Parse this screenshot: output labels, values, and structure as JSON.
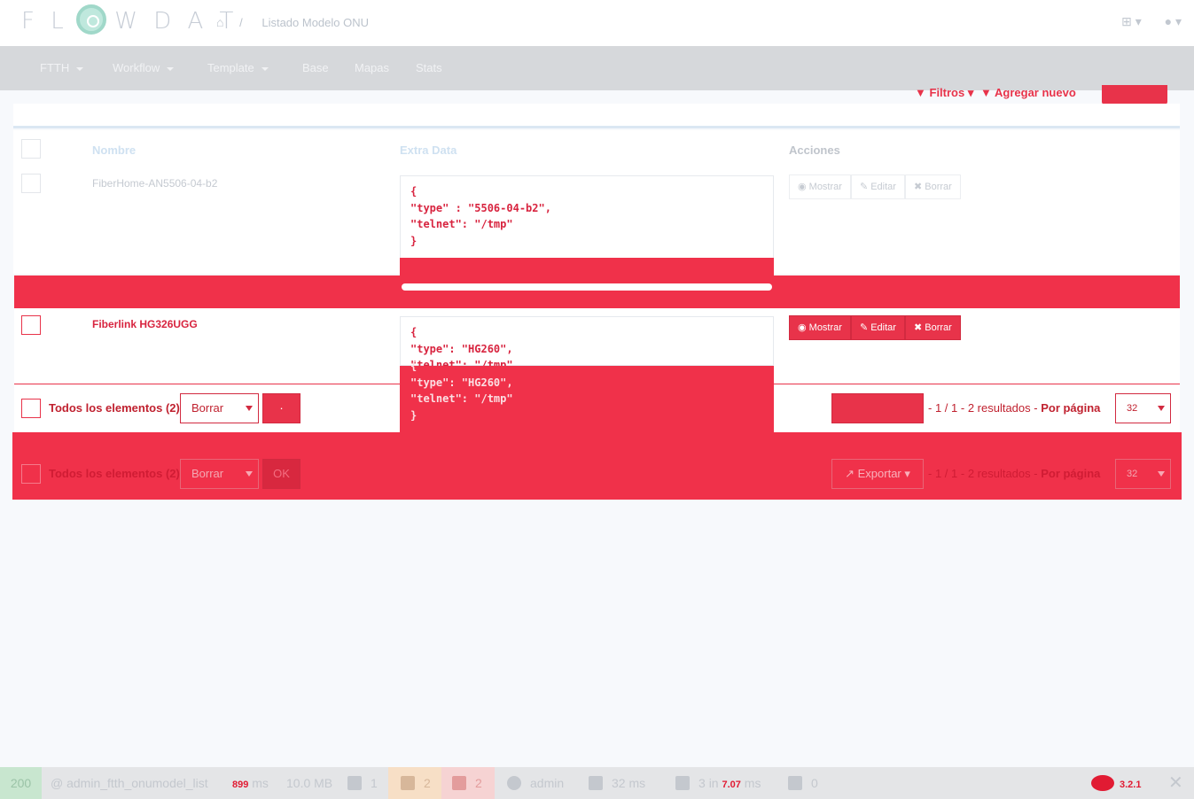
{
  "header": {
    "logo": "FLOWDAT",
    "breadcrumb": "Listado Modelo ONU",
    "plus_menu": "+",
    "user_menu": "▾"
  },
  "nav": {
    "items": [
      "FTTH",
      "Workflow",
      "Template",
      "Base",
      "Mapas",
      "Stats"
    ]
  },
  "list_actions": {
    "filtros": "Filtros",
    "agregar": "Agregar nuevo",
    "new_btn": ""
  },
  "table": {
    "columns": [
      "Nombre",
      "Extra Data",
      "Acciones"
    ],
    "rows": [
      {
        "nombre": "FiberHome-AN5506-04-b2",
        "extra": "{\n\"type\" : \"5506-04-b2\",\n\"telnet\": \"/tmp\"\n}"
      },
      {
        "nombre": "Fiberlink HG326UGG",
        "extra": "{\n\"type\": \"HG260\",\n\"telnet\": \"/tmp\"\n}"
      }
    ],
    "actions": {
      "show": "Mostrar",
      "edit": "Editar",
      "delete": "Borrar"
    }
  },
  "footer": {
    "all_elements": "Todos los elementos (2)",
    "batch_select": "Borrar",
    "ok": "OK",
    "export": "Exportar",
    "pagination": "1 / 1",
    "results": "2 resultados",
    "per_page_label": "Por página",
    "per_page_value": "32"
  },
  "debug_toolbar": {
    "status": "200",
    "route": "@ admin_ftth_onumodel_list",
    "time": "899",
    "time_unit": "ms",
    "memory": "10.0 MB",
    "forms": "1",
    "logs_warn": "2",
    "logs_err": "2",
    "user": "admin",
    "queries": "32",
    "queries_time": "ms",
    "cache": "3",
    "cache_unit": "in",
    "cache_time": "7.07",
    "cache_time_unit": "ms",
    "twig": "0",
    "version": "3.2.1"
  }
}
